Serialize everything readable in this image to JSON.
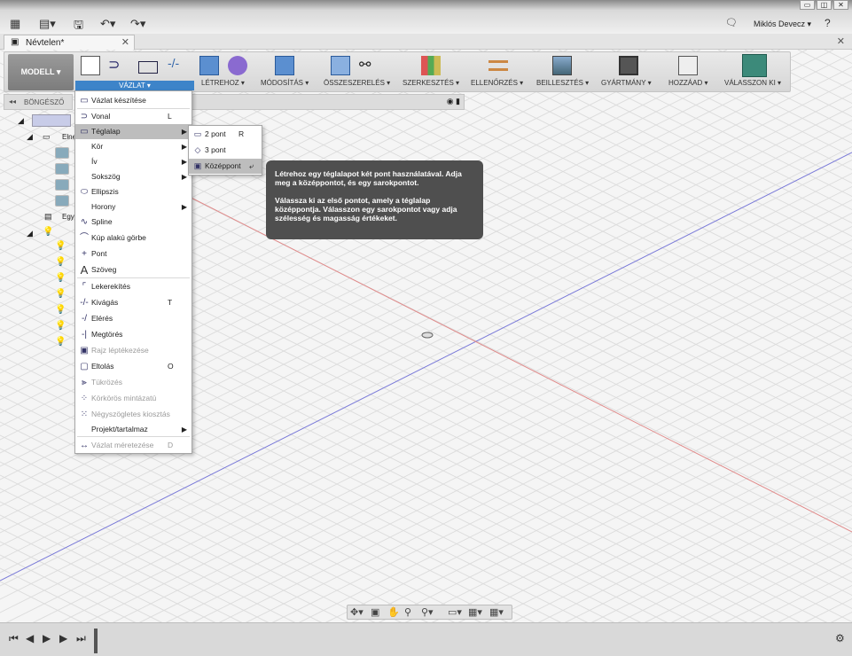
{
  "app": {
    "user": "Miklós Devecz ▾",
    "help": "?",
    "doc_tab": "Névtelen*",
    "close": "✕",
    "win": [
      "▭",
      "◫",
      "✕"
    ]
  },
  "toolbar": {
    "model": "MODELL ▾",
    "groups": [
      {
        "label": "VÁZLAT ▾"
      },
      {
        "label": "LÉTREHOZ ▾"
      },
      {
        "label": "MÓDOSÍTÁS ▾"
      },
      {
        "label": "ÖSSZESZERELÉS ▾"
      },
      {
        "label": "SZERKESZTÉS ▾"
      },
      {
        "label": "ELLENŐRZÉS ▾"
      },
      {
        "label": "BEILLESZTÉS ▾"
      },
      {
        "label": "GYÁRTMÁNY ▾"
      },
      {
        "label": "HOZZÁAD ▾"
      },
      {
        "label": "VÁLASSZON KI ▾"
      }
    ]
  },
  "browser": {
    "title": "BÖNGÉSZŐ",
    "row1": "Elne",
    "row2": "Egy"
  },
  "menu": {
    "items": [
      {
        "icon": "sketch-create-icon",
        "label": "Vázlat készítése",
        "shortcut": ""
      },
      {
        "icon": "line-icon",
        "label": "Vonal",
        "shortcut": "L"
      },
      {
        "icon": "rectangle-icon",
        "label": "Téglalap",
        "shortcut": ""
      },
      {
        "icon": "circle-icon",
        "label": "Kör",
        "shortcut": ""
      },
      {
        "icon": "arc-icon",
        "label": "Ív",
        "shortcut": ""
      },
      {
        "icon": "polygon-icon",
        "label": "Sokszög",
        "shortcut": ""
      },
      {
        "icon": "ellipse-icon",
        "label": "Ellipszis",
        "shortcut": ""
      },
      {
        "icon": "slot-icon",
        "label": "Horony",
        "shortcut": ""
      },
      {
        "icon": "spline-icon",
        "label": "Spline",
        "shortcut": ""
      },
      {
        "icon": "conic-icon",
        "label": "Kúp alakú görbe",
        "shortcut": ""
      },
      {
        "icon": "point-icon",
        "label": "Pont",
        "shortcut": ""
      },
      {
        "icon": "text-icon",
        "label": "Szöveg",
        "shortcut": ""
      },
      {
        "icon": "fillet-icon",
        "label": "Lekerekítés",
        "shortcut": ""
      },
      {
        "icon": "trim-icon",
        "label": "Kivágás",
        "shortcut": "T"
      },
      {
        "icon": "extend-icon",
        "label": "Elérés",
        "shortcut": ""
      },
      {
        "icon": "break-icon",
        "label": "Megtörés",
        "shortcut": ""
      },
      {
        "icon": "sketch-scale-icon",
        "label": "Rajz léptékezése",
        "shortcut": ""
      },
      {
        "icon": "offset-icon",
        "label": "Eltolás",
        "shortcut": "O"
      },
      {
        "icon": "mirror-icon",
        "label": "Tükrözés",
        "shortcut": ""
      },
      {
        "icon": "circular-pattern-icon",
        "label": "Körkörös mintázatú",
        "shortcut": ""
      },
      {
        "icon": "rect-pattern-icon",
        "label": "Négyszögletes kiosztás",
        "shortcut": ""
      },
      {
        "icon": "project-icon",
        "label": "Projekt/tartalmaz",
        "shortcut": ""
      },
      {
        "icon": "dimension-icon",
        "label": "Vázlat méretezése",
        "shortcut": "D"
      }
    ]
  },
  "submenu": {
    "items": [
      {
        "label": "2 pont",
        "shortcut": "R"
      },
      {
        "label": "3 pont",
        "shortcut": ""
      },
      {
        "label": "Középpont",
        "shortcut": ""
      }
    ]
  },
  "tooltip": {
    "p1": "Létrehoz egy téglalapot két pont használatával. Adja meg a középpontot, és egy sarokpontot.",
    "p2": "Válassza ki az első pontot, amely a téglalap középpontja. Válasszon egy sarokpontot vagy adja szélesség és magasság értékeket."
  },
  "nav": {
    "items": [
      "✥▾",
      "▣",
      "✋",
      "⚲",
      "⚲▾",
      "▭▾",
      "▦▾",
      "▦▾"
    ]
  },
  "timeline": {
    "items": [
      "⏮",
      "◀",
      "▶",
      "▶",
      "⏭"
    ],
    "gear": "⚙"
  }
}
